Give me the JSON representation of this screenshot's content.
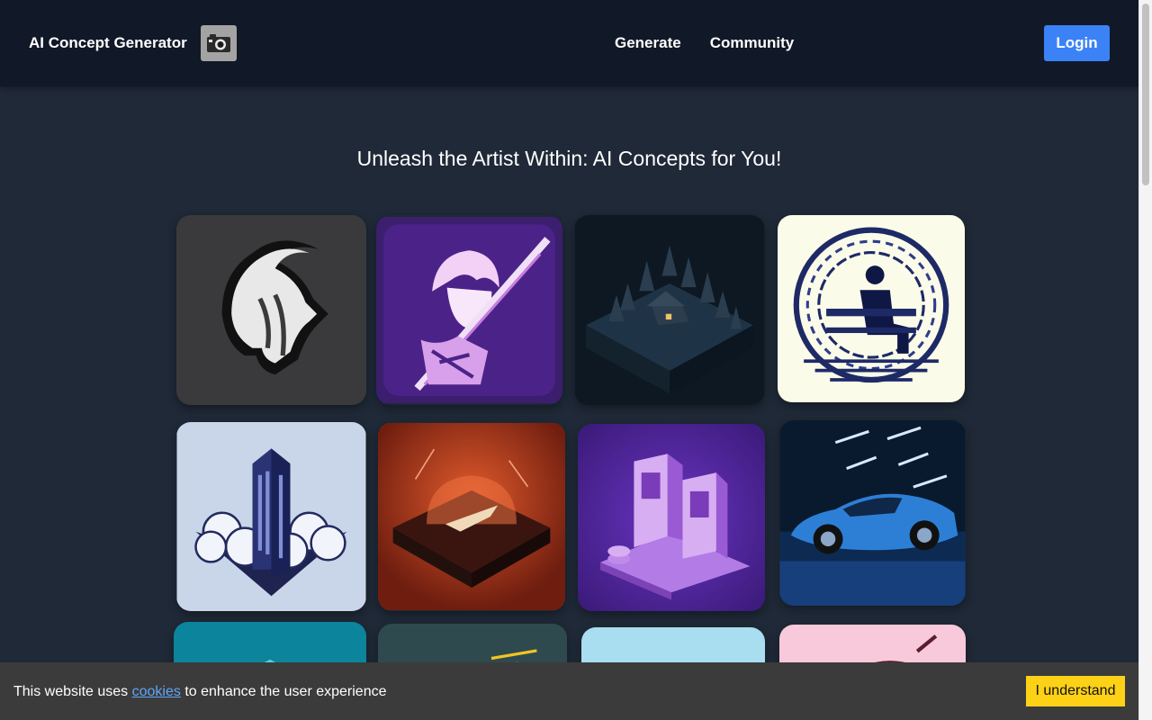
{
  "navbar": {
    "brand": "AI Concept Generator",
    "logo_icon": "camera-icon",
    "links": [
      "Generate",
      "Community"
    ],
    "login": "Login"
  },
  "hero": {
    "title": "Unleash the Artist Within: AI Concepts for You!"
  },
  "gallery": {
    "items": [
      {
        "icon": "goat-head-icon"
      },
      {
        "icon": "anime-swordsman-icon"
      },
      {
        "icon": "forest-cabin-icon"
      },
      {
        "icon": "bench-silhouette-icon"
      },
      {
        "icon": "skyscraper-clouds-icon"
      },
      {
        "icon": "spaceship-dome-icon"
      },
      {
        "icon": "vending-machine-icon"
      },
      {
        "icon": "sports-car-icon"
      },
      {
        "icon": "teal-art-icon"
      },
      {
        "icon": "yellow-car-icon"
      },
      {
        "icon": "sky-blue-art-icon"
      },
      {
        "icon": "pink-art-icon"
      }
    ]
  },
  "cookie": {
    "prefix": "This website uses",
    "link": "cookies",
    "suffix": "to enhance the user experience",
    "button": "I understand"
  }
}
